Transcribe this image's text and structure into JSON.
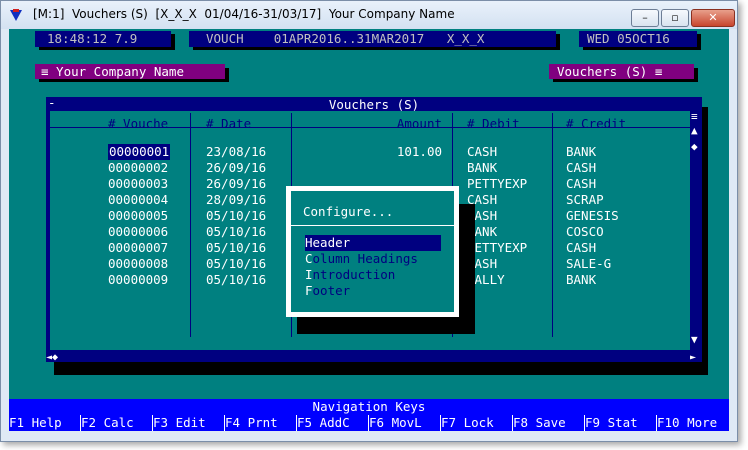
{
  "window": {
    "title": "[M:1]  Vouchers (S)  [X_X_X  01/04/16-31/03/17]  Your Company Name",
    "minimize_glyph": "–",
    "maximize_glyph": "▫",
    "close_glyph": "✕"
  },
  "status": {
    "time_version": "18:48:12 7.9",
    "module_range": "VOUCH    01APR2016..31MAR2017   X_X_X",
    "date": "WED 05OCT16"
  },
  "title_tags": {
    "company": "≡ Your Company Name",
    "screen": "Vouchers (S) ≡"
  },
  "voucher_window": {
    "title": "Vouchers (S)",
    "columns": [
      "# Vouche",
      "# Date",
      "Amount",
      "# Debit",
      "# Credit"
    ],
    "rows": [
      {
        "voucher": "00000001",
        "date": "23/08/16",
        "amount": "101.00",
        "debit": "CASH",
        "credit": "BANK"
      },
      {
        "voucher": "00000002",
        "date": "26/09/16",
        "amount": "",
        "debit": "BANK",
        "credit": "CASH"
      },
      {
        "voucher": "00000003",
        "date": "26/09/16",
        "amount": "",
        "debit": "PETTYEXP",
        "credit": "CASH"
      },
      {
        "voucher": "00000004",
        "date": "28/09/16",
        "amount": "",
        "debit": "CASH",
        "credit": "SCRAP"
      },
      {
        "voucher": "00000005",
        "date": "05/10/16",
        "amount": "",
        "debit": "CASH",
        "credit": "GENESIS"
      },
      {
        "voucher": "00000006",
        "date": "05/10/16",
        "amount": "",
        "debit": "BANK",
        "credit": "COSCO"
      },
      {
        "voucher": "00000007",
        "date": "05/10/16",
        "amount": "",
        "debit": "PETTYEXP",
        "credit": "CASH"
      },
      {
        "voucher": "00000008",
        "date": "05/10/16",
        "amount": "",
        "debit": "CASH",
        "credit": "SALE-G"
      },
      {
        "voucher": "00000009",
        "date": "05/10/16",
        "amount": "",
        "debit": "KALLY",
        "credit": "BANK"
      }
    ],
    "scroll_glyphs": {
      "menu": "≡",
      "up": "▲",
      "thumb": "◆",
      "down": "▼",
      "left": "◄◆",
      "right": "►"
    },
    "corner_glyph": "-"
  },
  "configure_popup": {
    "title": "Configure...",
    "items": [
      {
        "hot": "H",
        "rest": "eader",
        "selected": true
      },
      {
        "hot": "C",
        "rest": "olumn Headings",
        "selected": false
      },
      {
        "hot": "I",
        "rest": "ntroduction",
        "selected": false
      },
      {
        "hot": "F",
        "rest": "ooter",
        "selected": false
      }
    ]
  },
  "navigation_title": "Navigation Keys",
  "function_keys": [
    {
      "key": "F1",
      "label": "Help"
    },
    {
      "key": "F2",
      "label": "Calc"
    },
    {
      "key": "F3",
      "label": "Edit"
    },
    {
      "key": "F4",
      "label": "Prnt"
    },
    {
      "key": "F5",
      "label": "AddC"
    },
    {
      "key": "F6",
      "label": "MovL"
    },
    {
      "key": "F7",
      "label": "Lock"
    },
    {
      "key": "F8",
      "label": "Save"
    },
    {
      "key": "F9",
      "label": "Stat"
    },
    {
      "key": "F10",
      "label": "More"
    }
  ],
  "colors": {
    "console_bg": "#008080",
    "navy": "#000080",
    "magenta": "#800080",
    "function_bar": "#0000ff"
  }
}
